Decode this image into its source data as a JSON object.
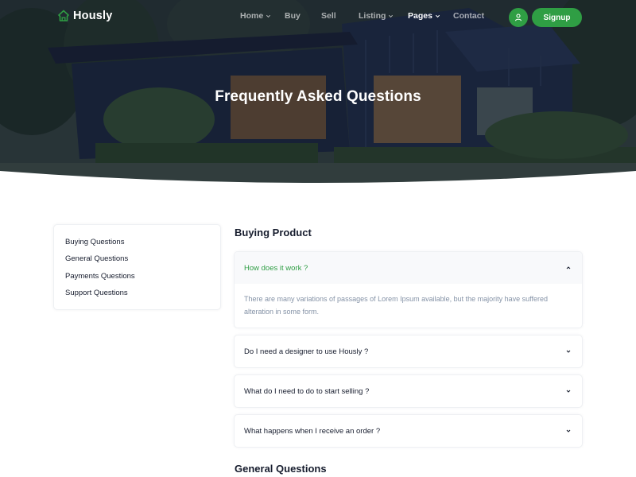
{
  "brand": {
    "name": "Hously",
    "accent": "#2f9e44"
  },
  "nav": {
    "items": [
      {
        "label": "Home",
        "has_dropdown": true,
        "active": false
      },
      {
        "label": "Buy",
        "has_dropdown": false,
        "active": false
      },
      {
        "label": "Sell",
        "has_dropdown": false,
        "active": false
      },
      {
        "label": "Listing",
        "has_dropdown": true,
        "active": false
      },
      {
        "label": "Pages",
        "has_dropdown": true,
        "active": true
      },
      {
        "label": "Contact",
        "has_dropdown": false,
        "active": false
      }
    ],
    "user_icon": "user-icon",
    "signup_label": "Signup"
  },
  "hero": {
    "title": "Frequently Asked Questions"
  },
  "sidebar": {
    "links": [
      {
        "label": "Buying Questions"
      },
      {
        "label": "General Questions"
      },
      {
        "label": "Payments Questions"
      },
      {
        "label": "Support Questions"
      }
    ]
  },
  "faq": {
    "sections": [
      {
        "title": "Buying Product",
        "items": [
          {
            "question": "How does it work ?",
            "expanded": true,
            "answer": "There are many variations of passages of Lorem Ipsum available, but the majority have suffered alteration in some form."
          },
          {
            "question": "Do I need a designer to use Hously ?",
            "expanded": false
          },
          {
            "question": "What do I need to do to start selling ?",
            "expanded": false
          },
          {
            "question": "What happens when I receive an order ?",
            "expanded": false
          }
        ]
      },
      {
        "title": "General Questions"
      }
    ]
  }
}
